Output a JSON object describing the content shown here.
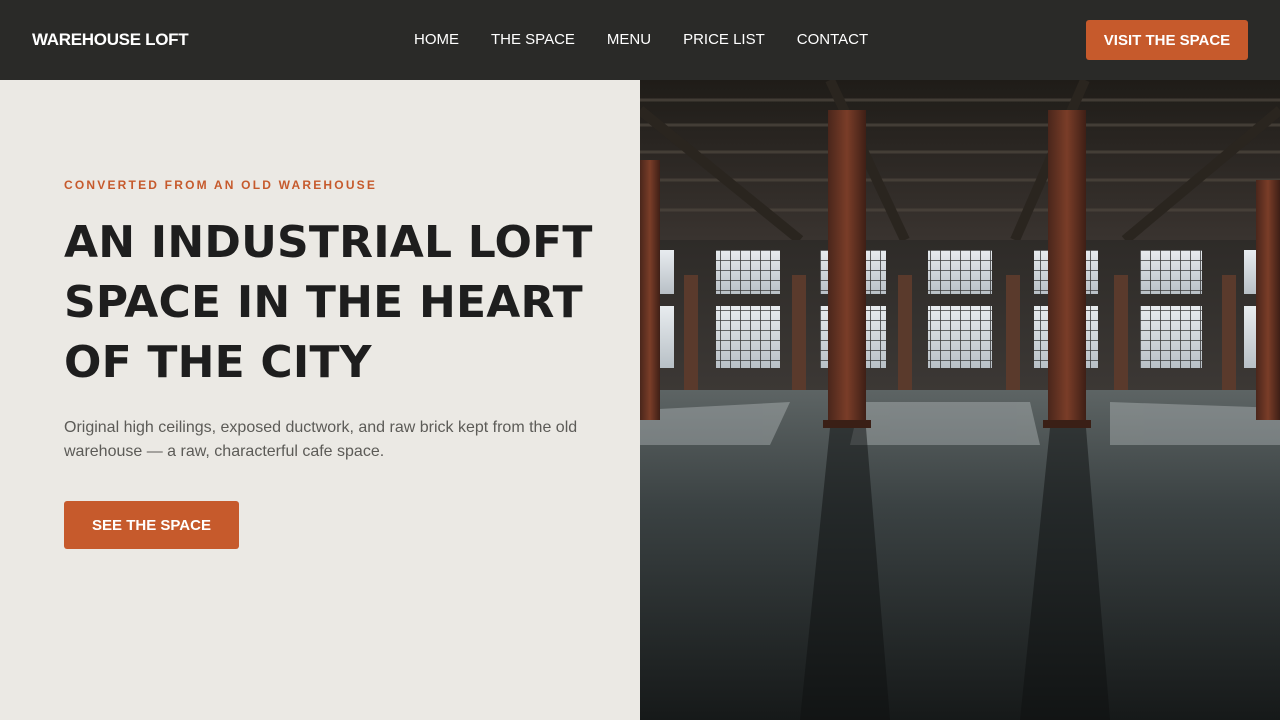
{
  "nav": {
    "brand": "WAREHOUSE LOFT",
    "items": [
      {
        "label": "HOME"
      },
      {
        "label": "THE SPACE"
      },
      {
        "label": "MENU"
      },
      {
        "label": "PRICE LIST"
      },
      {
        "label": "CONTACT"
      }
    ],
    "cta_label": "VISIT THE SPACE"
  },
  "hero": {
    "eyebrow": "CONVERTED FROM AN OLD WAREHOUSE",
    "headline": "AN INDUSTRIAL LOFT SPACE IN THE HEART OF THE CITY",
    "lead": "Original high ceilings, exposed ductwork, and raw brick kept from the old warehouse — a raw, characterful cafe space.",
    "cta_label": "SEE THE SPACE"
  },
  "colors": {
    "accent": "#c65a2c",
    "nav_bg": "#2a2a28",
    "page_bg": "#ebe9e4",
    "headline": "#1e1e1e"
  }
}
